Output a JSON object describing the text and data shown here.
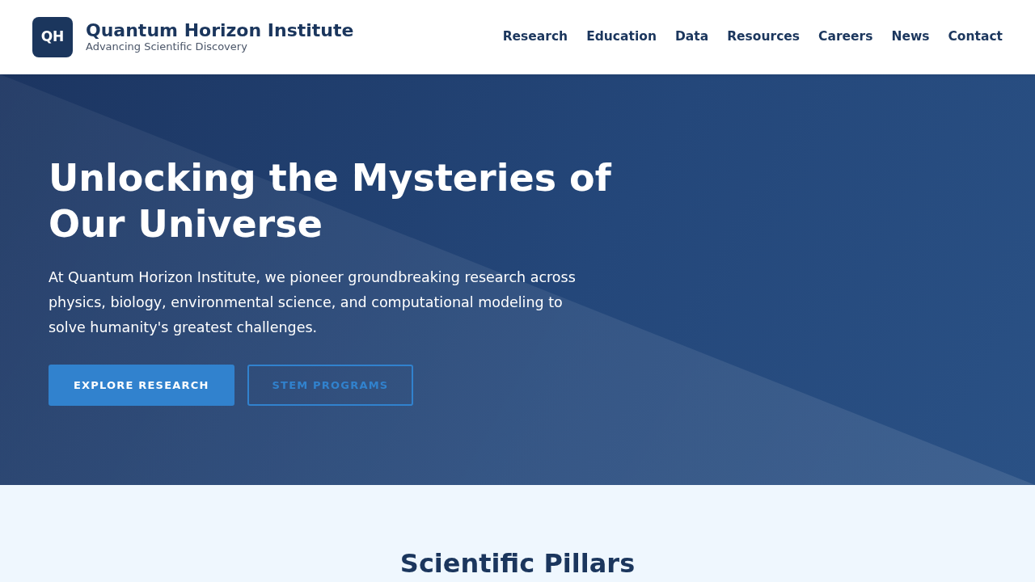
{
  "header": {
    "logo_mark": "QH",
    "title": "Quantum Horizon Institute",
    "tagline": "Advancing Scientific Discovery"
  },
  "nav": [
    {
      "label": "Research"
    },
    {
      "label": "Education"
    },
    {
      "label": "Data"
    },
    {
      "label": "Resources"
    },
    {
      "label": "Careers"
    },
    {
      "label": "News"
    },
    {
      "label": "Contact"
    }
  ],
  "hero": {
    "heading": "Unlocking the Mysteries of Our Universe",
    "text": "At Quantum Horizon Institute, we pioneer groundbreaking research across physics, biology, environmental science, and computational modeling to solve humanity's greatest challenges.",
    "buttons": [
      {
        "label": "EXPLORE RESEARCH",
        "kind": "primary"
      },
      {
        "label": "STEM PROGRAMS",
        "kind": "outline"
      }
    ]
  },
  "pillars": {
    "heading": "Scientific Pillars"
  }
}
